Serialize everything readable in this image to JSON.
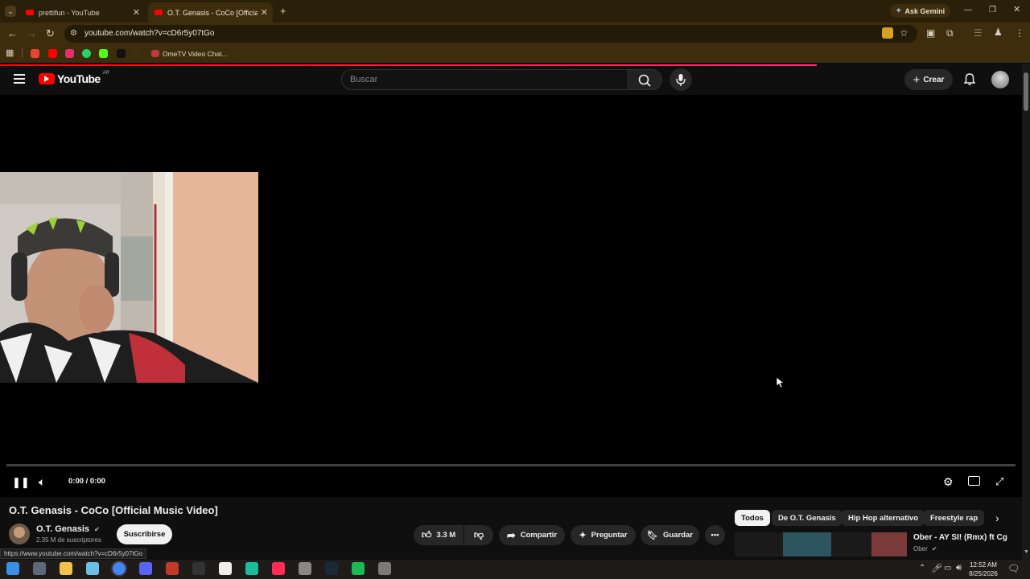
{
  "browser": {
    "tabs": [
      {
        "title": "prettifun - YouTube",
        "active": false
      },
      {
        "title": "O.T. Genasis - CoCo [Official M",
        "active": true
      }
    ],
    "new_tab": "+",
    "gemini_label": "Ask Gemini",
    "url": "youtube.com/watch?v=cD6r5y07tGo",
    "bookmarks": [
      {
        "name": "gmail",
        "color": "#ea4335"
      },
      {
        "name": "youtube",
        "color": "#ff0000"
      },
      {
        "name": "instagram",
        "color": "#e1306c"
      },
      {
        "name": "whatsapp",
        "color": "#25d366"
      },
      {
        "name": "kick",
        "color": "#53fc18"
      },
      {
        "name": "tiktok",
        "color": "#111111"
      },
      {
        "name": "ometv",
        "color": "#c0393b"
      }
    ],
    "bookmark_label": "OmeTV Video Chat...",
    "status_url": "https://www.youtube.com/watch?v=cD6r5y07tGo"
  },
  "youtube": {
    "logo_text": "YouTube",
    "region": "AR",
    "search_placeholder": "Buscar",
    "create_label": "Crear",
    "accent": "#ff0000"
  },
  "player": {
    "time": "0:00 / 0:00"
  },
  "video": {
    "title": "O.T. Genasis - CoCo [Official Music Video]",
    "channel": "O.T. Genasis",
    "subscribers": "2.35 M de suscriptores",
    "subscribe_label": "Suscribirse",
    "likes": "3.3 M",
    "share_label": "Compartir",
    "ask_label": "Preguntar",
    "save_label": "Guardar"
  },
  "chips": [
    "Todos",
    "De O.T. Genasis",
    "Hip Hop alternativo",
    "Freestyle rap"
  ],
  "suggestion": {
    "title": "Ober - AY SI! (Rmx) ft Cg",
    "channel": "Ober"
  },
  "taskbar": {
    "apps": [
      {
        "name": "start",
        "color": "#3a8ee6"
      },
      {
        "name": "task-view",
        "color": "#5a6a7a"
      },
      {
        "name": "file-explorer",
        "color": "#f2c14e"
      },
      {
        "name": "notepad",
        "color": "#6cc0e8"
      },
      {
        "name": "chrome",
        "color": "#4285f4"
      },
      {
        "name": "discord",
        "color": "#5865f2"
      },
      {
        "name": "app-red",
        "color": "#c0392b"
      },
      {
        "name": "epic-games",
        "color": "#333333"
      },
      {
        "name": "capcut",
        "color": "#eeeeee"
      },
      {
        "name": "app-teal",
        "color": "#1abc9c"
      },
      {
        "name": "tiktok-app",
        "color": "#ff2d55"
      },
      {
        "name": "obs",
        "color": "#888888"
      },
      {
        "name": "steam",
        "color": "#1b2838"
      },
      {
        "name": "spotify",
        "color": "#1db954"
      },
      {
        "name": "app-game",
        "color": "#7a7a7a"
      }
    ],
    "time": "12:52 AM",
    "date": "8/25/2026"
  }
}
